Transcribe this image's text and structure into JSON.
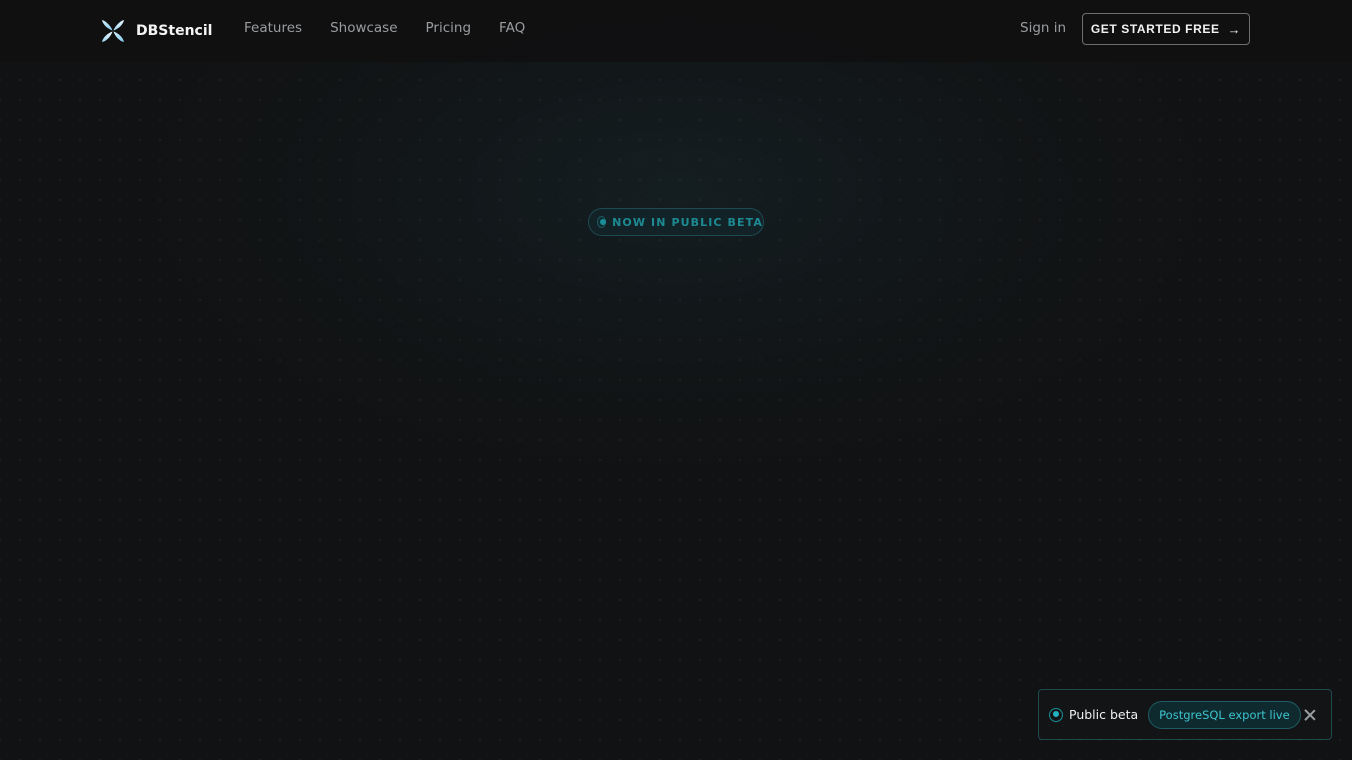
{
  "brand": {
    "name": "DBStencil",
    "logo_icon": "butterfly-x-logo-icon"
  },
  "nav": {
    "links": [
      {
        "label": "Features"
      },
      {
        "label": "Showcase"
      },
      {
        "label": "Pricing"
      },
      {
        "label": "FAQ"
      }
    ],
    "sign_in_label": "Sign in",
    "cta_label": "GET STARTED FREE",
    "cta_icon": "arrow-right-icon"
  },
  "hero": {
    "beta_pill_label": "NOW IN PUBLIC BETA"
  },
  "toast": {
    "label": "Public beta",
    "badge": "PostgreSQL export live",
    "close_icon": "close-icon"
  },
  "colors": {
    "background": "#111213",
    "accent": "#1d8a93",
    "accent_bright": "#3cc4cf"
  }
}
